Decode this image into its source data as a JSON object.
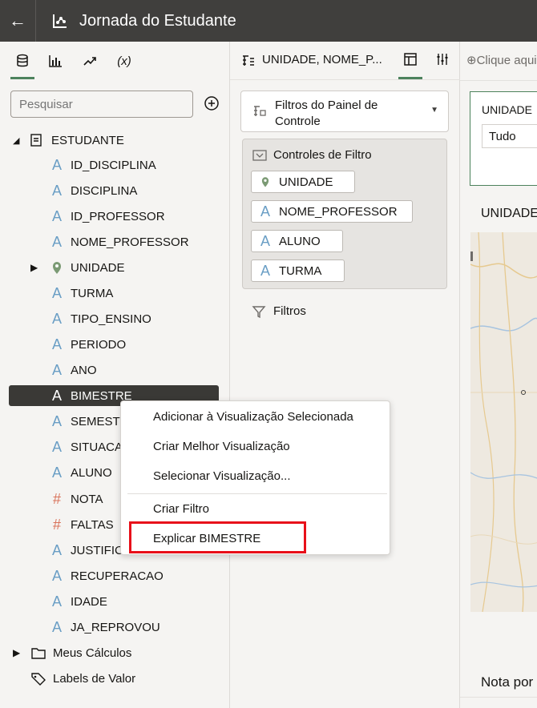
{
  "app": {
    "title": "Jornada do Estudante",
    "back_icon": "arrow-left-icon"
  },
  "left": {
    "tabs": [
      {
        "icon": "database-icon",
        "active": true
      },
      {
        "icon": "bar-chart-icon"
      },
      {
        "icon": "trend-line-icon"
      },
      {
        "label": "(x)",
        "icon": "calculation-icon"
      }
    ],
    "search_placeholder": "Pesquisar",
    "dataset": "ESTUDANTE",
    "fields": [
      {
        "label": "ID_DISCIPLINA",
        "type": "A"
      },
      {
        "label": "DISCIPLINA",
        "type": "A"
      },
      {
        "label": "ID_PROFESSOR",
        "type": "A"
      },
      {
        "label": "NOME_PROFESSOR",
        "type": "A"
      },
      {
        "label": "UNIDADE",
        "type": "geo"
      },
      {
        "label": "TURMA",
        "type": "A"
      },
      {
        "label": "TIPO_ENSINO",
        "type": "A"
      },
      {
        "label": "PERIODO",
        "type": "A"
      },
      {
        "label": "ANO",
        "type": "A"
      },
      {
        "label": "BIMESTRE",
        "type": "A",
        "selected": true
      },
      {
        "label": "SEMESTR",
        "type": "A"
      },
      {
        "label": "SITUACA",
        "type": "A"
      },
      {
        "label": "ALUNO",
        "type": "A"
      },
      {
        "label": "NOTA",
        "type": "#"
      },
      {
        "label": "FALTAS",
        "type": "#"
      },
      {
        "label": "JUSTIFIC",
        "type": "A"
      },
      {
        "label": "RECUPERACAO",
        "type": "A"
      },
      {
        "label": "IDADE",
        "type": "A"
      },
      {
        "label": "JA_REPROVOU",
        "type": "A"
      }
    ],
    "meus_calculos": "Meus Cálculos",
    "labels_valor": "Labels de Valor"
  },
  "mid": {
    "title": "UNIDADE, NOME_P...",
    "filtros_painel": "Filtros do Painel de Controle",
    "controles_filtro": "Controles de Filtro",
    "chips": [
      "UNIDADE",
      "NOME_PROFESSOR",
      "ALUNO",
      "TURMA"
    ],
    "filtros": "Filtros"
  },
  "right": {
    "clique": "Clique aqui",
    "unidade": "UNIDADE",
    "tudo": "Tudo",
    "unidade2": "UNIDADE",
    "nota": "Nota por"
  },
  "menu": {
    "items": [
      "Adicionar à Visualização Selecionada",
      "Criar Melhor Visualização",
      "Selecionar Visualização...",
      "Criar Filtro",
      "Explicar BIMESTRE"
    ]
  },
  "colors": {
    "accent": "#4c825c",
    "highlight": "#e8101a",
    "attribute": "#6a9ec5",
    "measure": "#d9735b"
  }
}
